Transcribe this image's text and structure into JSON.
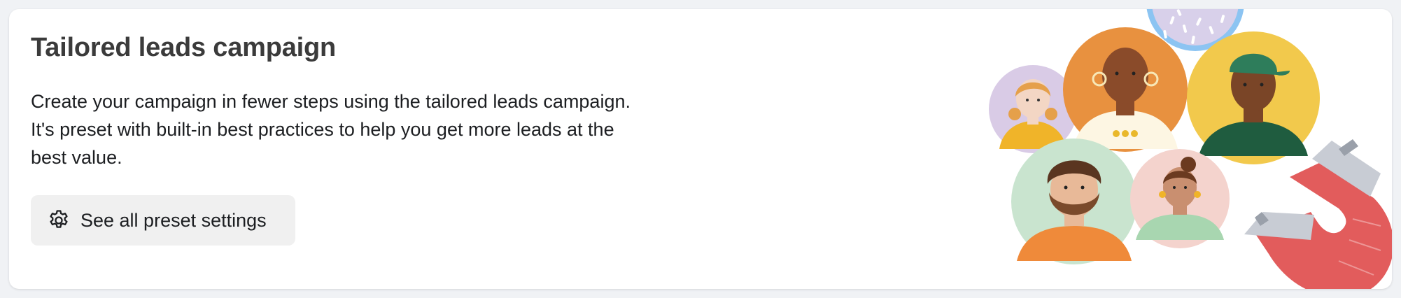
{
  "card": {
    "title": "Tailored leads campaign",
    "description_lines": [
      "Create your campaign in fewer steps using the tailored leads campaign.",
      "It's preset with built-in best practices to help you get more leads at the",
      "best value."
    ],
    "button": {
      "label": "See all preset settings",
      "icon": "gear-icon"
    }
  },
  "illustration": {
    "name": "people-magnet-illustration",
    "colors": {
      "magnet_red": "#e25c5c",
      "magnet_tip": "#c8ccd4",
      "circle_lavender": "#d9cbe6",
      "circle_orange": "#e8913f",
      "circle_yellow": "#f2c94c",
      "circle_green": "#c9e4cf",
      "circle_pink": "#f4d3cd",
      "circle_top": "#d8d0ea",
      "accent_blue": "#8cc4f2"
    }
  }
}
